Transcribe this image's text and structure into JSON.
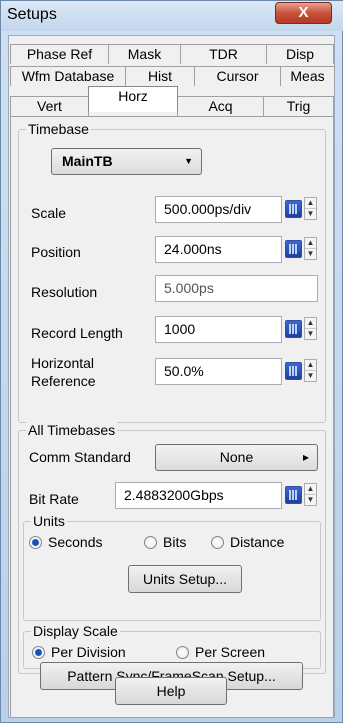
{
  "window": {
    "title": "Setups",
    "close_label": "X"
  },
  "tabs": {
    "row1": [
      "Phase Ref",
      "Mask",
      "TDR",
      "Disp"
    ],
    "row2": [
      "Wfm Database",
      "Hist",
      "Cursor",
      "Meas"
    ],
    "row3": [
      "Vert",
      "Horz",
      "Acq",
      "Trig"
    ],
    "active": "Horz"
  },
  "timebase": {
    "legend": "Timebase",
    "selected": "MainTB",
    "scale_label": "Scale",
    "scale_value": "500.000ps/div",
    "position_label": "Position",
    "position_value": "24.000ns",
    "resolution_label": "Resolution",
    "resolution_value": "5.000ps",
    "record_length_label": "Record Length",
    "record_length_value": "1000",
    "horizontal_reference_label_1": "Horizontal",
    "horizontal_reference_label_2": "Reference",
    "horizontal_reference_value": "50.0%"
  },
  "all_timebases": {
    "legend": "All Timebases",
    "comm_standard_label": "Comm Standard",
    "comm_standard_value": "None",
    "bit_rate_label": "Bit Rate",
    "bit_rate_value": "2.4883200Gbps"
  },
  "units": {
    "legend": "Units",
    "options": [
      "Seconds",
      "Bits",
      "Distance"
    ],
    "selected": "Seconds",
    "setup_button": "Units Setup..."
  },
  "display_scale": {
    "legend": "Display Scale",
    "options": [
      "Per Division",
      "Per Screen"
    ],
    "selected": "Per Division"
  },
  "pattern_sync_button": "Pattern Sync/FrameScan Setup...",
  "help_button": "Help",
  "spin_up": "▲",
  "spin_down": "▼",
  "dropdown_arrow": "▼",
  "right_arrow": "▸"
}
